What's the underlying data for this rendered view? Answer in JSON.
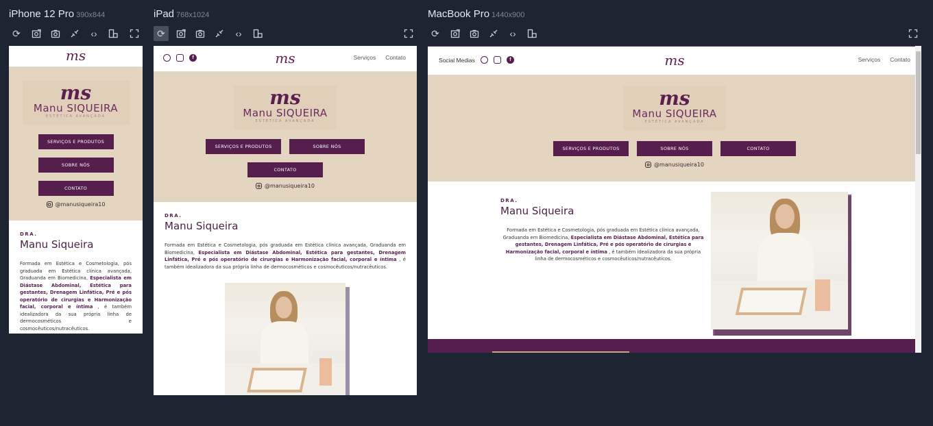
{
  "devices": {
    "iphone": {
      "name": "iPhone 12 Pro",
      "size": "390x844"
    },
    "ipad": {
      "name": "iPad",
      "size": "768x1024"
    },
    "macbook": {
      "name": "MacBook Pro",
      "size": "1440x900"
    }
  },
  "toolbar_icons": [
    "refresh-icon",
    "screenshot-full-icon",
    "camera-icon",
    "network-icon",
    "code-icon",
    "rotate-icon",
    "fullscreen-icon"
  ],
  "site": {
    "logo": "ms",
    "brand_ms": "ms",
    "brand_name_1": "Manu",
    "brand_name_2": "SIQUEIRA",
    "brand_sub": "ESTÉTICA AVANÇADA",
    "nav_social_label": "Social Medias",
    "nav_services": "Serviços",
    "nav_contact": "Contato",
    "btn_services": "SERVIÇOS E PRODUTOS",
    "btn_about": "SOBRE NÓS",
    "btn_contact": "CONTATO",
    "instagram": "@manusiqueira10",
    "dra": "DRA.",
    "name": "Manu Siqueira",
    "bio_1": "Formada em Estética e Cosmetologia, pós graduada em Estética clínica avançada, Graduanda em Biomedicina, ",
    "bio_bold": "Especialista em Diástase Abdominal, Estética para gestantes, Drenagem Linfática, Pré e pós operatório de cirurgias e Harmonização facial, corporal e íntima",
    "bio_2": " , é também idealizadora da sua própria linha de dermocosméticos e cosmocêuticos/nutracêuticos."
  },
  "colors": {
    "brand": "#561e4d",
    "hero_bg": "#e4d5c1",
    "app_bg": "#1d2533"
  }
}
